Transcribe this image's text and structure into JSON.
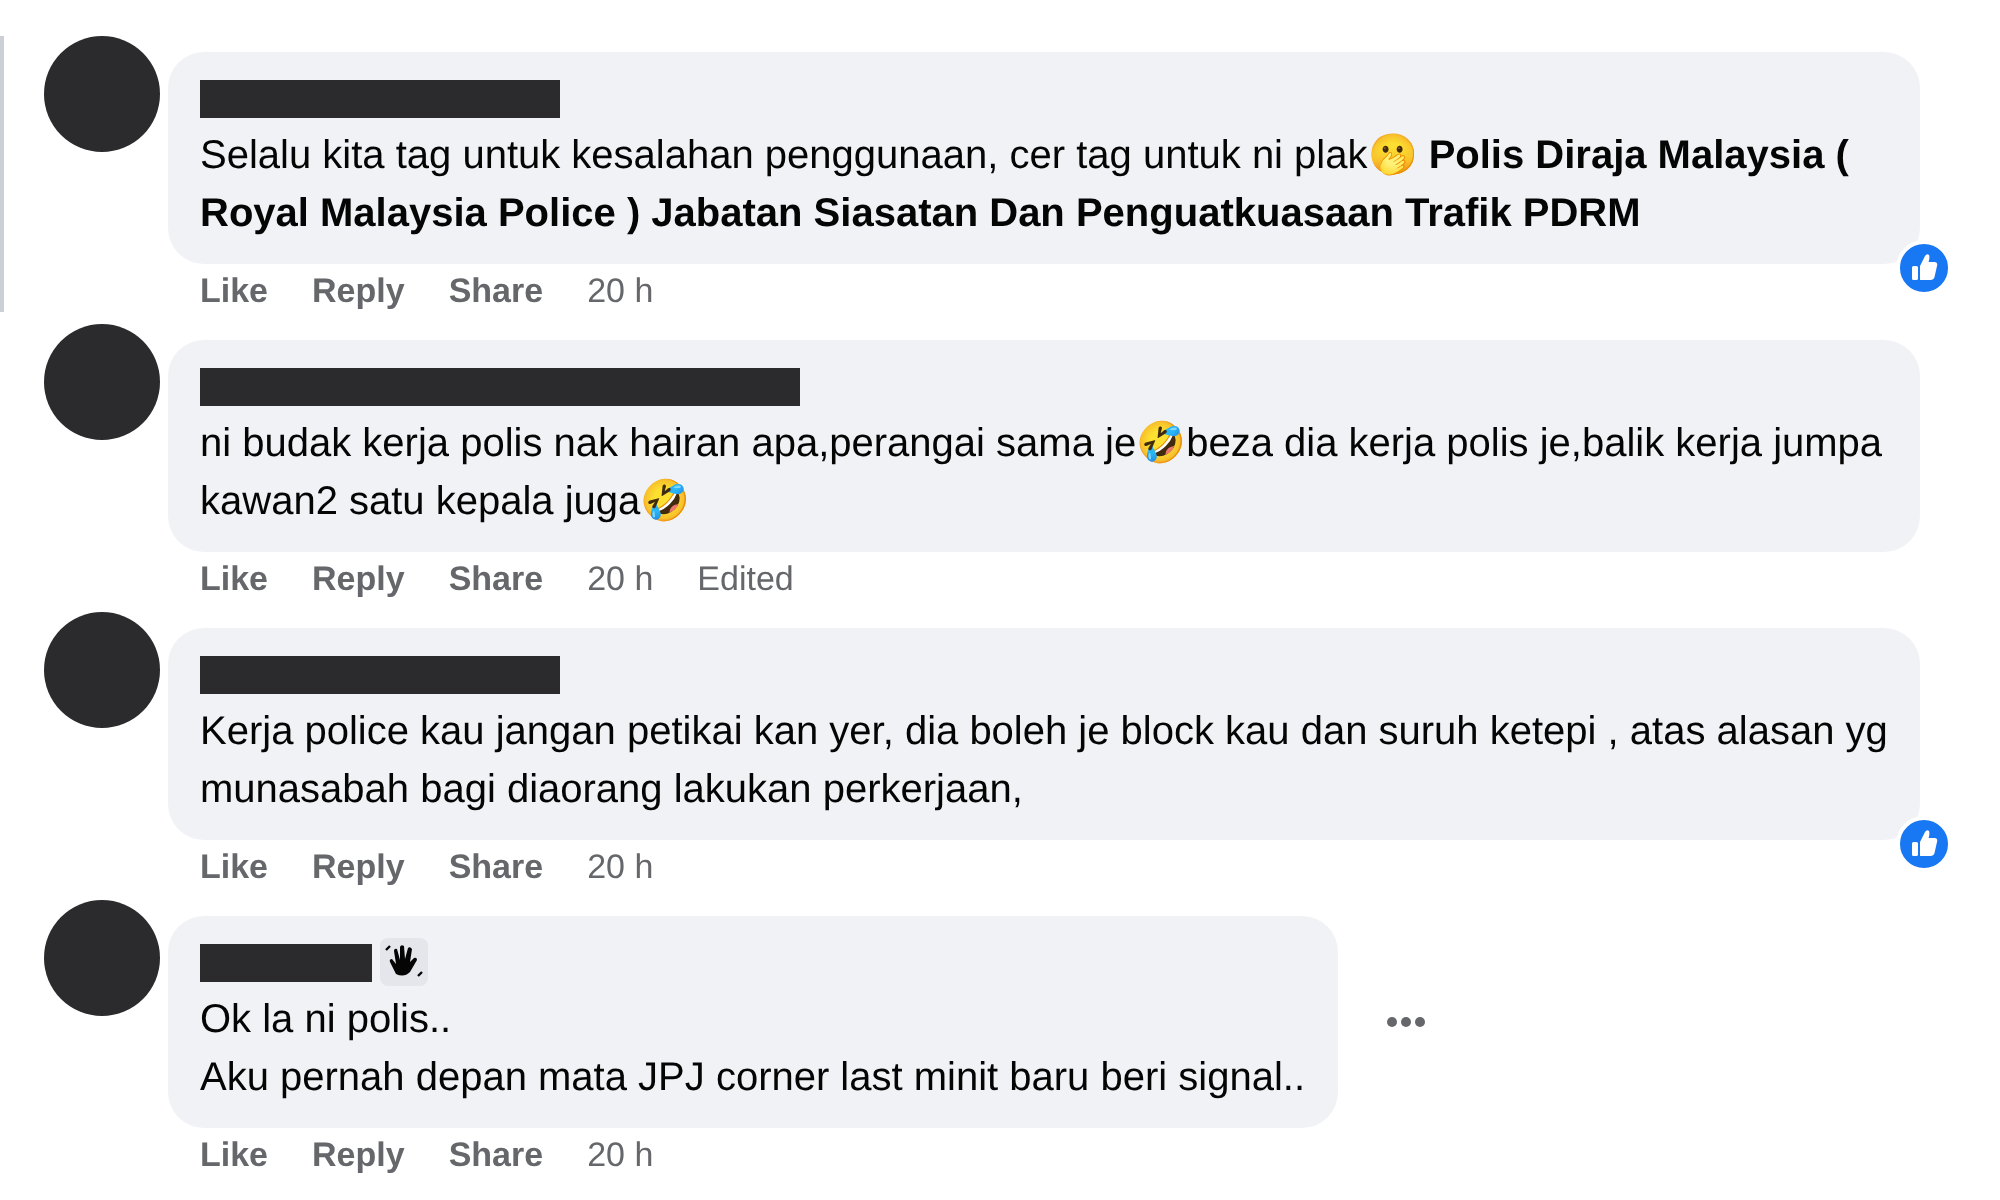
{
  "comments": [
    {
      "text": "Selalu kita tag untuk kesalahan penggunaan, cer tag untuk ni plak🫢 **Polis Diraja Malaysia ( Royal Malaysia Police ) Jabatan Siasatan Dan Penguatkuasaan Trafik PDRM**",
      "liked": true,
      "actions": [
        "Like",
        "Reply",
        "Share"
      ],
      "time": "20 h"
    },
    {
      "text": "ni budak kerja polis nak hairan apa,perangai sama je🤣beza dia kerja polis je,balik kerja jumpa kawan2 satu kepala juga🤣",
      "actions": [
        "Like",
        "Reply",
        "Share"
      ],
      "time": "20 h",
      "edited": "Edited"
    },
    {
      "text": "Kerja police kau jangan petikai kan yer, dia boleh je block kau dan suruh ketepi , atas alasan yg munasabah bagi diaorang lakukan perkerjaan,",
      "liked": true,
      "actions": [
        "Like",
        "Reply",
        "Share"
      ],
      "time": "20 h"
    },
    {
      "text": "Ok la ni polis..\nAku pernah depan mata JPJ corner last minit baru beri signal..",
      "member_badge": true,
      "more_menu": true,
      "actions": [
        "Like",
        "Reply",
        "Share"
      ],
      "time": "20 h"
    }
  ]
}
